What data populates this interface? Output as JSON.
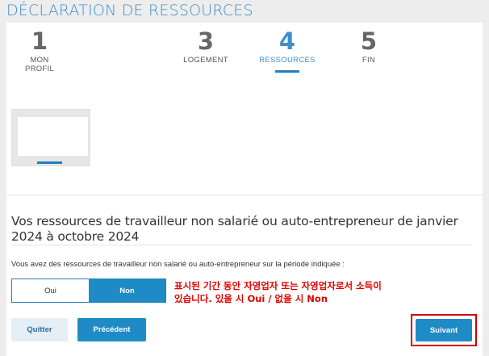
{
  "page": {
    "title": "DÉCLARATION DE RESSOURCES"
  },
  "stepper": {
    "steps": [
      {
        "number": "1",
        "label": "MON PROFIL"
      },
      {
        "number": "3",
        "label": "LOGEMENT"
      },
      {
        "number": "4",
        "label": "RESSOURCES"
      },
      {
        "number": "5",
        "label": "FIN"
      }
    ],
    "active_step": "4"
  },
  "section": {
    "title": "Vos ressources de travailleur non salarié ou auto-entrepreneur de janvier 2024 à octobre 2024",
    "question": "Vous avez des ressources de travailleur non salarié ou auto-entrepreneur sur la période indiquée :",
    "options": [
      "Oui",
      "Non"
    ],
    "selected_option": "Non"
  },
  "annotation": {
    "line1": "표시된 기간 동안 자영업자 또는 자영업자로서 소득이",
    "line2": "있습니다. 있을 시 Oui / 없을 시 Non"
  },
  "actions": {
    "quit_label": "Quitter",
    "previous_label": "Précédent",
    "next_label": "Suivant"
  },
  "colors": {
    "accent": "#1f8bc6",
    "title_blue": "#3d8fc6",
    "annotation_red": "#e00000",
    "highlight_border": "#d40000"
  }
}
